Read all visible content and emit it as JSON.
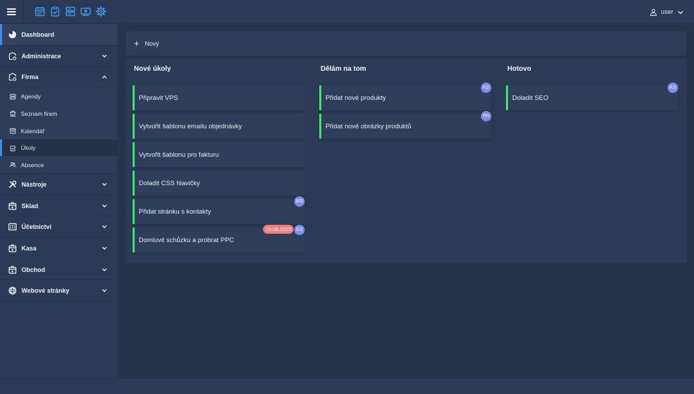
{
  "colors": {
    "accent": "#3d8ee8",
    "card_border": "#3fe46a",
    "avatar": "#7d8ee6",
    "due_badge": "#f07c7c"
  },
  "topbar": {
    "menu_icon": "hamburger-icon",
    "icons": [
      "calendar-icon",
      "clipboard-check-icon",
      "server-icon",
      "cash-icon",
      "gear-icon"
    ],
    "user_label": "user"
  },
  "sidebar": {
    "items": [
      {
        "label": "Dashboard",
        "icon": "pie-chart-icon"
      },
      {
        "label": "Administrace",
        "icon": "building-gear-icon"
      },
      {
        "label": "Firma",
        "icon": "building-gear-icon"
      },
      {
        "label": "Nástroje",
        "icon": "tools-icon"
      },
      {
        "label": "Sklad",
        "icon": "box-icon"
      },
      {
        "label": "Účetnictví",
        "icon": "calculator-icon"
      },
      {
        "label": "Kasa",
        "icon": "register-icon"
      },
      {
        "label": "Obchod",
        "icon": "shop-icon"
      },
      {
        "label": "Webové stránky",
        "icon": "globe-icon"
      }
    ],
    "firma_sub": [
      {
        "label": "Agendy",
        "icon": "stack-icon"
      },
      {
        "label": "Seznam firem",
        "icon": "building-icon"
      },
      {
        "label": "Kalendář",
        "icon": "calendar-icon"
      },
      {
        "label": "Úkoly",
        "icon": "clipboard-check-icon"
      },
      {
        "label": "Absence",
        "icon": "users-icon"
      }
    ]
  },
  "toolbar": {
    "new_label": "Nový"
  },
  "board": {
    "columns": [
      {
        "title": "Nové úkoly",
        "cards": [
          {
            "text": "Připravit VPS"
          },
          {
            "text": "Vytvořit šablonu emailu objednávky"
          },
          {
            "text": "Vytvořit šablonu pro fakturu"
          },
          {
            "text": "Doladit CSS hlavičky"
          },
          {
            "text": "Přidat stránku s kontakty",
            "avatar": "MS"
          },
          {
            "text": "Domluvit schůzku a probrat PPC",
            "avatar": "ES",
            "due": "15.08.2025"
          }
        ]
      },
      {
        "title": "Dělám na tom",
        "cards": [
          {
            "text": "Přidat nové produkty",
            "avatar": "KS"
          },
          {
            "text": "Přidat nové obrázky produktů",
            "avatar": "PN"
          }
        ]
      },
      {
        "title": "Hotovo",
        "cards": [
          {
            "text": "Doladit SEO",
            "avatar": "KS"
          }
        ]
      }
    ]
  }
}
